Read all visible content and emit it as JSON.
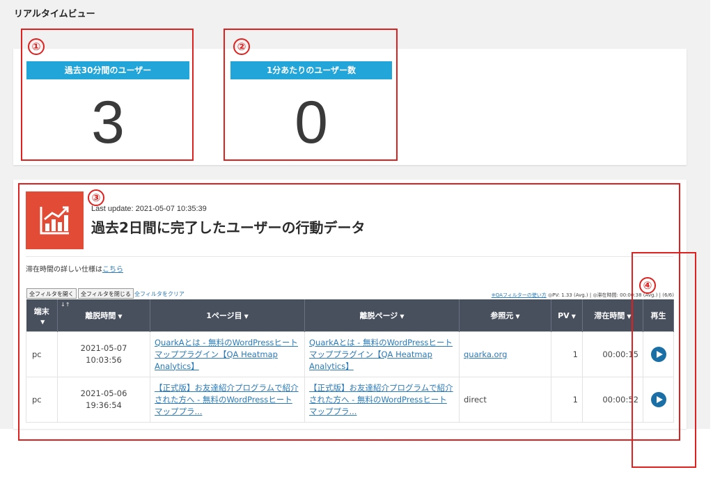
{
  "page": {
    "title": "リアルタイムビュー"
  },
  "stats": [
    {
      "marker": "①",
      "label": "過去30分間のユーザー",
      "value": "3"
    },
    {
      "marker": "②",
      "label": "1分あたりのユーザー数",
      "value": "0"
    }
  ],
  "panel": {
    "marker": "③",
    "last_update": "Last update: 2021-05-07 10:35:39",
    "heading": "過去2日間に完了したユーザーの行動データ",
    "spec_note_prefix": "滞在時間の詳しい仕様は",
    "spec_note_link": "こちら",
    "filter_open": "全フィルタを開く",
    "filter_close": "全フィルタを閉じる",
    "filter_clear": "全フィルタをクリア",
    "qa_filter_link": "※QAフィルターの使い方",
    "stats_summary": "◎PV: 1.33 (Avg.) | ◎滞在時間: 00:00:38 (Avg.) | (6/6)"
  },
  "replay_marker": "④",
  "table": {
    "columns": [
      "端末",
      "離脱時間",
      "1ページ目",
      "離脱ページ",
      "参照元",
      "PV",
      "滞在時間",
      "再生"
    ],
    "rows": [
      {
        "device": "pc",
        "exit_time": "2021-05-07 10:03:56",
        "first_page": "QuarkAとは - 無料のWordPressヒートマッププラグイン【QA Heatmap Analytics】",
        "exit_page": "QuarkAとは - 無料のWordPressヒートマッププラグイン【QA Heatmap Analytics】",
        "referrer": "quarka.org",
        "pv": "1",
        "duration": "00:00:15"
      },
      {
        "device": "pc",
        "exit_time": "2021-05-06 19:36:54",
        "first_page": "【正式版】お友達紹介プログラムで紹介された方へ - 無料のWordPressヒートマッププラ...",
        "exit_page": "【正式版】お友達紹介プログラムで紹介された方へ - 無料のWordPressヒートマッププラ...",
        "referrer": "direct",
        "pv": "1",
        "duration": "00:00:52"
      }
    ]
  },
  "colors": {
    "accent": "#22a5d9",
    "annotation": "#e0201e",
    "header": "#48505e",
    "icon_tile": "#e24b35"
  },
  "icons": [
    "bar-chart-icon",
    "play-icon",
    "caret-down-icon",
    "sort-icon"
  ]
}
